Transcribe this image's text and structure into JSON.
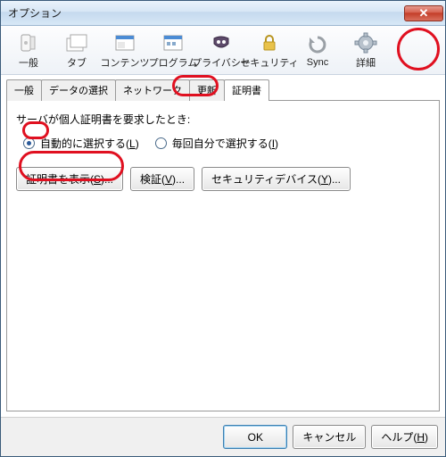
{
  "window": {
    "title": "オプション"
  },
  "toolbar": {
    "items": [
      {
        "label": "一般"
      },
      {
        "label": "タブ"
      },
      {
        "label": "コンテンツ"
      },
      {
        "label": "プログラム"
      },
      {
        "label": "プライバシー"
      },
      {
        "label": "セキュリティ"
      },
      {
        "label": "Sync"
      },
      {
        "label": "詳細"
      }
    ]
  },
  "subtabs": {
    "items": [
      {
        "label": "一般"
      },
      {
        "label": "データの選択"
      },
      {
        "label": "ネットワーク"
      },
      {
        "label": "更新"
      },
      {
        "label": "証明書"
      }
    ],
    "active": 4
  },
  "panel": {
    "heading": "サーバが個人証明書を要求したとき:",
    "radio_auto_prefix": "自動的に選択する(",
    "radio_auto_key": "L",
    "radio_auto_suffix": ")",
    "radio_each_prefix": "毎回自分で選択する(",
    "radio_each_key": "I",
    "radio_each_suffix": ")",
    "btn_view_prefix": "証明書を表示(",
    "btn_view_key": "S",
    "btn_view_suffix": ")...",
    "btn_verify_prefix": "検証(",
    "btn_verify_key": "V",
    "btn_verify_suffix": ")...",
    "btn_devices_prefix": "セキュリティデバイス(",
    "btn_devices_key": "Y",
    "btn_devices_suffix": ")..."
  },
  "footer": {
    "ok": "OK",
    "cancel": "キャンセル",
    "help_prefix": "ヘルプ(",
    "help_key": "H",
    "help_suffix": ")"
  }
}
